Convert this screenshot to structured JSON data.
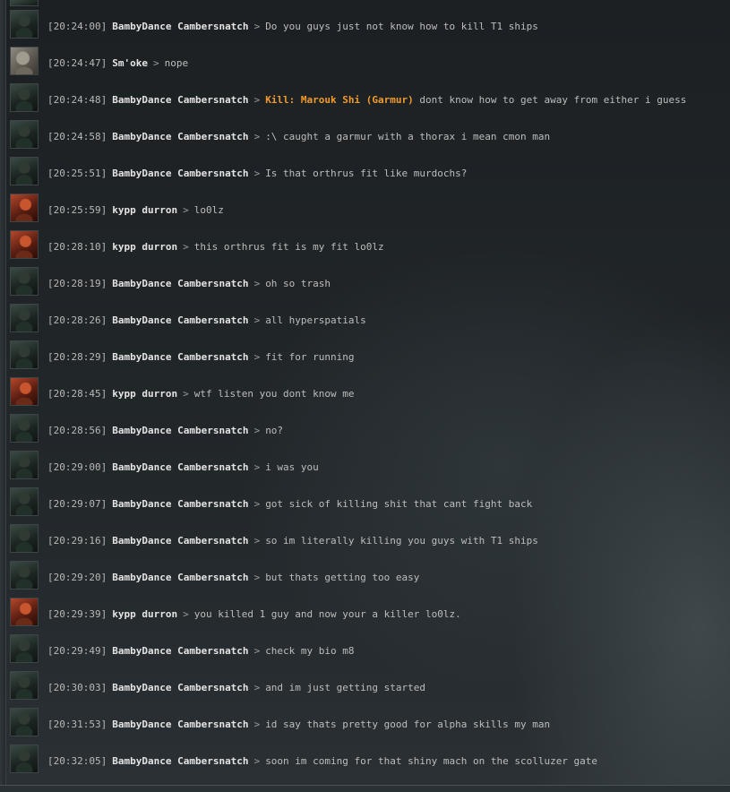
{
  "chat": {
    "messages": [
      {
        "time": "[20:24:00]",
        "sender": "BambyDance Cambersnatch",
        "avatar": "bambydance",
        "text": "Do you guys just not know how to kill T1 ships"
      },
      {
        "time": "[20:24:47]",
        "sender": "Sm'oke",
        "avatar": "smoke",
        "text": "nope"
      },
      {
        "time": "[20:24:48]",
        "sender": "BambyDance Cambersnatch",
        "avatar": "bambydance",
        "link": "Kill: Marouk Shi (Garmur)",
        "text": "dont know how to get away from either i guess"
      },
      {
        "time": "[20:24:58]",
        "sender": "BambyDance Cambersnatch",
        "avatar": "bambydance",
        "text": ":\\ caught a garmur with a thorax i mean cmon man"
      },
      {
        "time": "[20:25:51]",
        "sender": "BambyDance Cambersnatch",
        "avatar": "bambydance",
        "text": "Is that orthrus fit like murdochs?"
      },
      {
        "time": "[20:25:59]",
        "sender": "kypp durron",
        "avatar": "kypp",
        "text": "lo0lz"
      },
      {
        "time": "[20:28:10]",
        "sender": "kypp durron",
        "avatar": "kypp",
        "text": "this orthrus fit is my fit lo0lz"
      },
      {
        "time": "[20:28:19]",
        "sender": "BambyDance Cambersnatch",
        "avatar": "bambydance",
        "text": "oh so trash"
      },
      {
        "time": "[20:28:26]",
        "sender": "BambyDance Cambersnatch",
        "avatar": "bambydance",
        "text": "all hyperspatials"
      },
      {
        "time": "[20:28:29]",
        "sender": "BambyDance Cambersnatch",
        "avatar": "bambydance",
        "text": "fit for running"
      },
      {
        "time": "[20:28:45]",
        "sender": "kypp durron",
        "avatar": "kypp",
        "text": "wtf listen you dont know me"
      },
      {
        "time": "[20:28:56]",
        "sender": "BambyDance Cambersnatch",
        "avatar": "bambydance",
        "text": "no?"
      },
      {
        "time": "[20:29:00]",
        "sender": "BambyDance Cambersnatch",
        "avatar": "bambydance",
        "text": "i was you"
      },
      {
        "time": "[20:29:07]",
        "sender": "BambyDance Cambersnatch",
        "avatar": "bambydance",
        "text": "got sick of killing shit that cant fight back"
      },
      {
        "time": "[20:29:16]",
        "sender": "BambyDance Cambersnatch",
        "avatar": "bambydance",
        "text": "so im literally killing you guys with T1 ships"
      },
      {
        "time": "[20:29:20]",
        "sender": "BambyDance Cambersnatch",
        "avatar": "bambydance",
        "text": "but thats getting too easy"
      },
      {
        "time": "[20:29:39]",
        "sender": "kypp durron",
        "avatar": "kypp",
        "text": "you killed 1 guy and now your a killer lo0lz."
      },
      {
        "time": "[20:29:49]",
        "sender": "BambyDance Cambersnatch",
        "avatar": "bambydance",
        "text": "check my bio m8"
      },
      {
        "time": "[20:30:03]",
        "sender": "BambyDance Cambersnatch",
        "avatar": "bambydance",
        "text": "and im just getting started"
      },
      {
        "time": "[20:31:53]",
        "sender": "BambyDance Cambersnatch",
        "avatar": "bambydance",
        "text": "id say thats pretty good for alpha skills my man"
      },
      {
        "time": "[20:32:05]",
        "sender": "BambyDance Cambersnatch",
        "avatar": "bambydance",
        "text": "soon im coming for that shiny mach on the scolluzer gate"
      }
    ],
    "separator": ">"
  },
  "colors": {
    "link": "#f39a2b",
    "sender": "#e4e4e4",
    "text": "#bdbdbd",
    "background": "#1b1f22"
  }
}
